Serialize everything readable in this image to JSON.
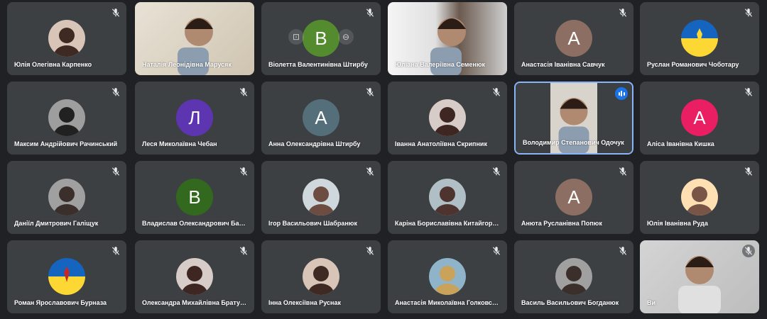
{
  "meeting": {
    "colors": {
      "background": "#202124",
      "tile": "#3c4043",
      "speaking_border": "#8ab4f8",
      "speaking_badge": "#1a73e8"
    },
    "participants": [
      {
        "name": "Юлія Олегівна Карпенко",
        "avatar_type": "photo",
        "mic": "muted-icon"
      },
      {
        "name": "Наталія Леонідівна Марусяк",
        "avatar_type": "video",
        "mic": "none"
      },
      {
        "name": "Віолетта Валентинівна Штирбу",
        "avatar_type": "letter",
        "letter": "В",
        "color": "#558b2f",
        "mic": "muted-icon"
      },
      {
        "name": "Юліана Валеріївна Семенюк",
        "avatar_type": "video",
        "mic": "none"
      },
      {
        "name": "Анастасія Іванівна Савчук",
        "avatar_type": "letter",
        "letter": "А",
        "color": "#8d6e63",
        "mic": "muted-icon"
      },
      {
        "name": "Руслан Романович Чоботару",
        "avatar_type": "flag",
        "mic": "muted-icon"
      },
      {
        "name": "Максим Андрійович Рачинський",
        "avatar_type": "photo",
        "mic": "muted-icon"
      },
      {
        "name": "Леся Миколаївна Чебан",
        "avatar_type": "letter",
        "letter": "Л",
        "color": "#5e35b1",
        "mic": "muted-icon"
      },
      {
        "name": "Анна Олександрівна Штирбу",
        "avatar_type": "letter",
        "letter": "А",
        "color": "#546e7a",
        "mic": "muted-icon"
      },
      {
        "name": "Іванна Анатоліївна Скрипник",
        "avatar_type": "photo",
        "mic": "muted-icon"
      },
      {
        "name": "Володимир Степанович Одочук",
        "avatar_type": "video",
        "mic": "speaking-icon"
      },
      {
        "name": "Аліса Іванівна Кишка",
        "avatar_type": "letter",
        "letter": "А",
        "color": "#e91e63",
        "mic": "muted-icon"
      },
      {
        "name": "Даніїл Дмитрович Галіщук",
        "avatar_type": "photo",
        "mic": "muted-icon"
      },
      {
        "name": "Владислав Олександрович Бан…",
        "avatar_type": "letter",
        "letter": "В",
        "color": "#33691e",
        "mic": "muted-icon"
      },
      {
        "name": "Ігор Васильович Шабранюк",
        "avatar_type": "photo",
        "mic": "muted-icon"
      },
      {
        "name": "Каріна Бориславівна Китайгоро…",
        "avatar_type": "photo",
        "mic": "muted-icon"
      },
      {
        "name": "Анюта Русланівна Попюк",
        "avatar_type": "letter",
        "letter": "А",
        "color": "#8d6e63",
        "mic": "muted-icon"
      },
      {
        "name": "Юлія Іванівна Руда",
        "avatar_type": "photo",
        "mic": "muted-icon"
      },
      {
        "name": "Роман Ярославович Бурназа",
        "avatar_type": "flag",
        "mic": "muted-icon"
      },
      {
        "name": "Олександра Михайлівна Брату…",
        "avatar_type": "photo",
        "mic": "muted-icon"
      },
      {
        "name": "Інна Олексіївна Руснак",
        "avatar_type": "photo",
        "mic": "muted-icon"
      },
      {
        "name": "Анастасія Миколаївна Голковсь…",
        "avatar_type": "photo",
        "mic": "muted-icon"
      },
      {
        "name": "Василь Васильович Богданюк",
        "avatar_type": "photo",
        "mic": "muted-icon"
      },
      {
        "name": "Ви",
        "avatar_type": "video",
        "mic": "muted-icon"
      }
    ]
  }
}
